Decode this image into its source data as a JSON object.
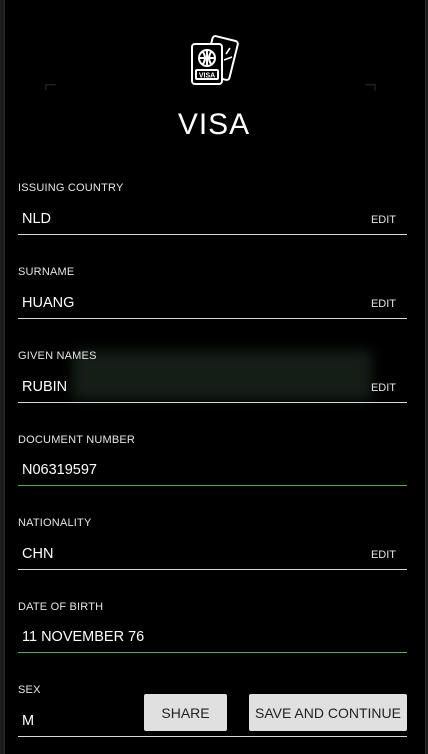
{
  "header": {
    "icon": "passport-visa-icon",
    "title": "VISA"
  },
  "fields": [
    {
      "label": "ISSUING COUNTRY",
      "value": "NLD",
      "edit": "EDIT"
    },
    {
      "label": "SURNAME",
      "value": "HUANG",
      "edit": "EDIT"
    },
    {
      "label": "GIVEN NAMES",
      "value": "RUBIN",
      "edit": "EDIT"
    },
    {
      "label": "DOCUMENT NUMBER",
      "value": "N06319597",
      "edit": ""
    },
    {
      "label": "NATIONALITY",
      "value": "CHN",
      "edit": "EDIT"
    },
    {
      "label": "DATE OF BIRTH",
      "value": "11 NOVEMBER 76",
      "edit": ""
    },
    {
      "label": "SEX",
      "value": "M",
      "edit": ""
    }
  ],
  "actions": {
    "share": "SHARE",
    "save": "SAVE AND CONTINUE"
  },
  "colors": {
    "background": "#000000",
    "active_underline": "#4caf50",
    "button": "#e0e0e0"
  }
}
